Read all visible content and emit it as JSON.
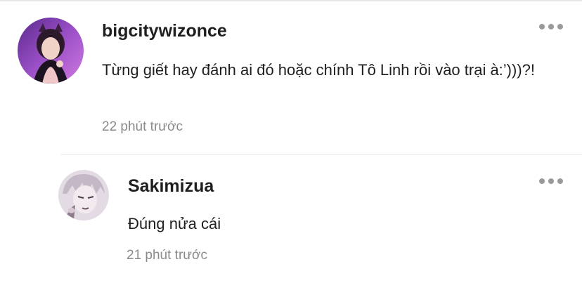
{
  "comments": [
    {
      "username": "bigcitywizonce",
      "text": "Từng giết hay đánh ai đó hoặc chính Tô Linh rồi vào trại à:’)))?!",
      "time": "22 phút trước",
      "more_icon": "more-horizontal-icon",
      "avatar_colors": {
        "bg": "#7a3fa8",
        "accent": "#c86bd8"
      }
    },
    {
      "username": "Sakimizua",
      "text": "Đúng nửa cái",
      "time": "21 phút trước",
      "more_icon": "more-horizontal-icon",
      "avatar_colors": {
        "bg": "#dcd3dd",
        "accent": "#7c6a78"
      }
    }
  ]
}
